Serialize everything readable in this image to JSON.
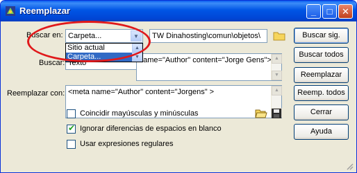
{
  "window": {
    "title": "Reemplazar"
  },
  "search_in": {
    "label": "Buscar en:",
    "selected": "Carpeta...",
    "options": [
      "Sitio actual",
      "Carpeta..."
    ],
    "path": "TW Dinahosting\\comun\\objetos\\"
  },
  "search": {
    "label": "Buscar:",
    "type_value": "Texto",
    "value": "name=\"Author\" content=\"Jorge Gens\">"
  },
  "replace": {
    "label": "Reemplazar con:",
    "value": "<meta name=\"Author\" content=\"Jorgens\" >"
  },
  "options": {
    "match_case": "Coincidir mayúsculas y minúsculas",
    "ignore_whitespace": "Ignorar diferencias de espacios en blanco",
    "regex": "Usar expresiones regulares"
  },
  "buttons": {
    "find_next": "Buscar sig.",
    "find_all": "Buscar todos",
    "replace": "Reemplazar",
    "replace_all": "Reemp. todos",
    "close": "Cerrar",
    "help": "Ayuda"
  },
  "colors": {
    "titlebar": "#0055e5",
    "highlight_ring": "#e0191b",
    "selection": "#316ac5"
  }
}
